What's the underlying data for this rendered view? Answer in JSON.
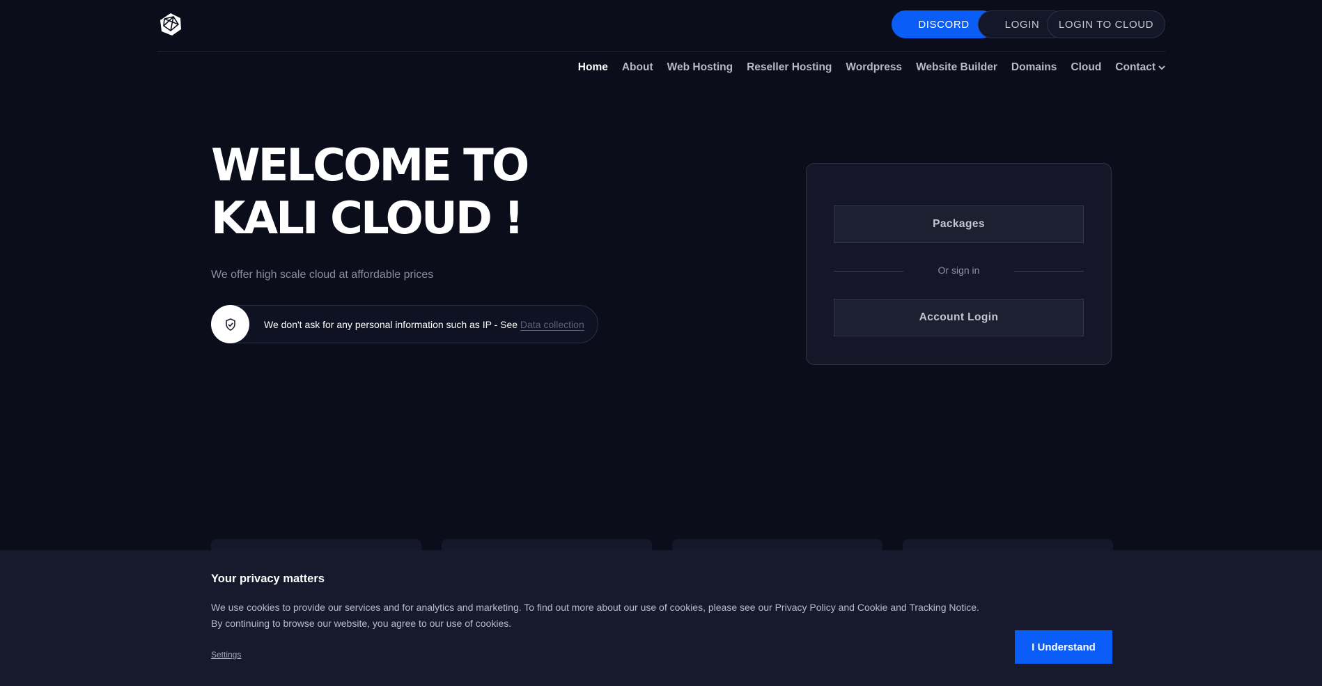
{
  "header": {
    "logo_icon": "polyhedron-logo-icon",
    "buttons": {
      "discord": "DISCORD",
      "login": "LOGIN",
      "login_cloud": "LOGIN TO CLOUD"
    }
  },
  "nav": {
    "items": [
      "Home",
      "About",
      "Web Hosting",
      "Reseller Hosting",
      "Wordpress",
      "Website Builder",
      "Domains",
      "Cloud",
      "Contact"
    ],
    "active": "Home"
  },
  "hero": {
    "title_line1": "WELCOME TO",
    "title_line2": "KALI CLOUD !",
    "subtitle": "We offer high scale cloud at affordable prices",
    "notice_icon": "shield-icon",
    "notice_text": "We don't ask for any personal information such as IP - See",
    "notice_link": "Data collection"
  },
  "card": {
    "packages": "Packages",
    "divider": "Or sign in",
    "account_login": "Account Login"
  },
  "cookie": {
    "title": "Your privacy matters",
    "line1": "We use cookies to provide our services and for analytics and marketing. To find out more about our use of cookies, please see our Privacy Policy and Cookie and Tracking Notice.",
    "line2": "By continuing to browse our website, you agree to our use of cookies.",
    "settings": "Settings",
    "accept": "I Understand"
  },
  "colors": {
    "background": "#0b0d1b",
    "accent": "#0a5df6",
    "card": "#151728"
  }
}
